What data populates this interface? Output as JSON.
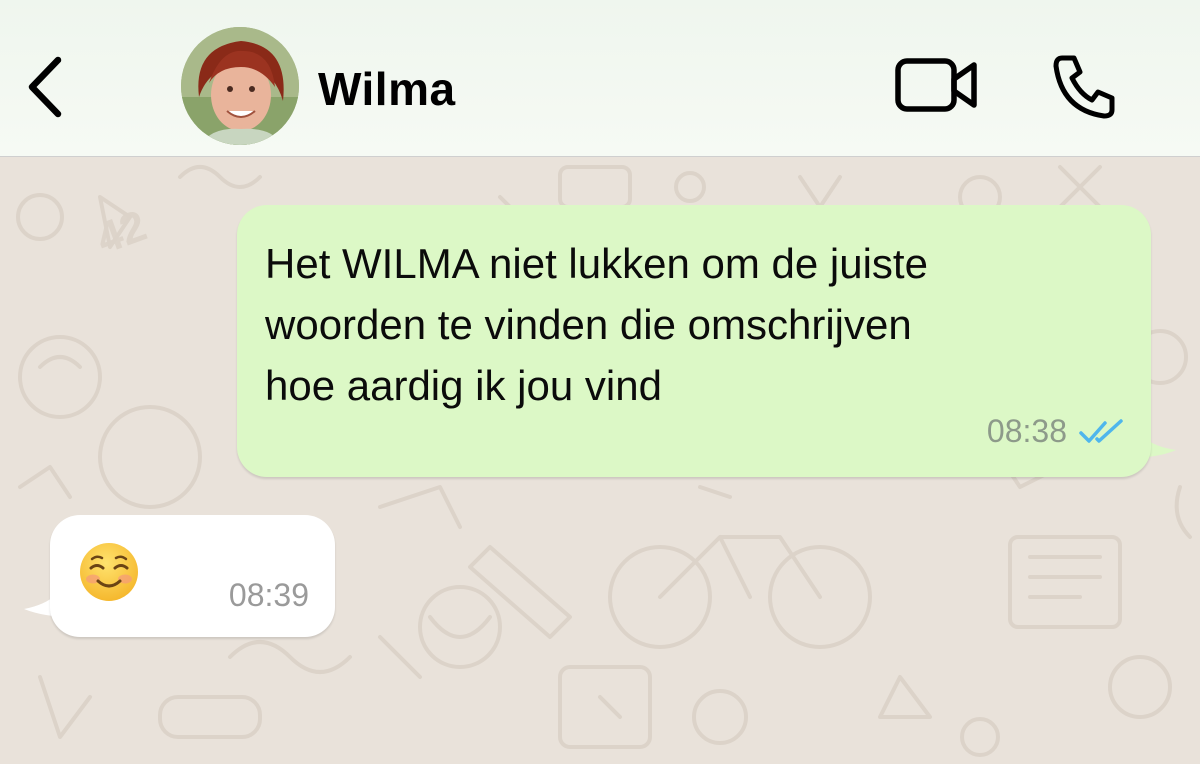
{
  "header": {
    "contact_name": "Wilma",
    "back_icon": "chevron-left-icon",
    "video_icon": "video-camera-icon",
    "phone_icon": "phone-icon"
  },
  "messages": [
    {
      "direction": "outgoing",
      "text": "Het WILMA niet lukken om de juiste\nwoorden te vinden die omschrijven\nhoe aardig ik jou vind",
      "time": "08:38",
      "status": "read",
      "status_icon": "double-check-icon"
    },
    {
      "direction": "incoming",
      "text": "☺️",
      "emoji_icon": "smiling-face-icon",
      "time": "08:39"
    }
  ],
  "colors": {
    "outgoing_bubble": "#dcf8c6",
    "incoming_bubble": "#ffffff",
    "wallpaper": "#e9e2da",
    "read_ticks": "#4fb6ec"
  }
}
